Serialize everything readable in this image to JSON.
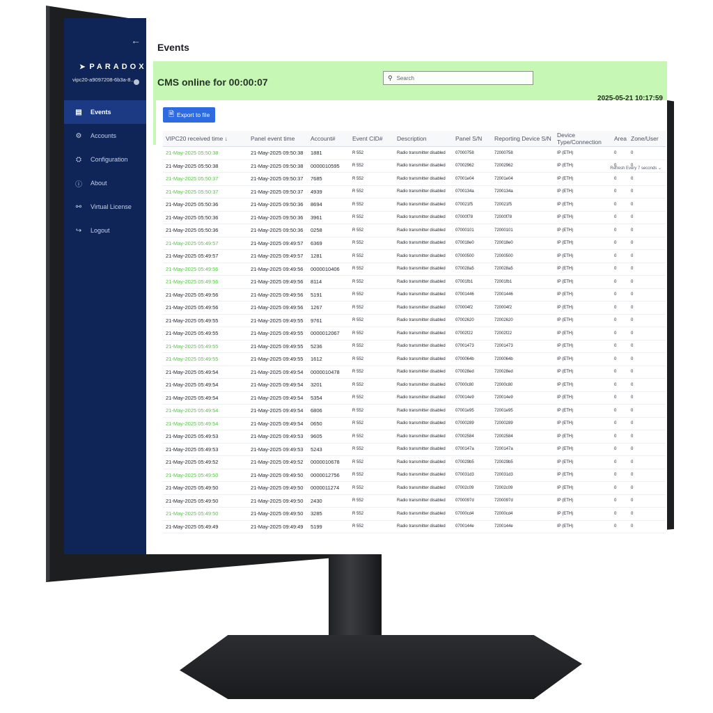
{
  "sidebar": {
    "brand": "PARADOX",
    "device_id": "vipc20-a9097208-6b3a-8...",
    "collapse_icon": "arrow-left-icon",
    "items": [
      {
        "label": "Events",
        "icon": "list-icon",
        "active": true
      },
      {
        "label": "Accounts",
        "icon": "accounts-icon"
      },
      {
        "label": "Configuration",
        "icon": "gear-icon"
      },
      {
        "label": "About",
        "icon": "info-icon"
      },
      {
        "label": "Virtual License",
        "icon": "key-icon"
      },
      {
        "label": "Logout",
        "icon": "logout-icon"
      }
    ]
  },
  "header": {
    "title": "Events",
    "cms_status": "CMS online for 00:00:07",
    "search_placeholder": "Search",
    "datetime": "2025-05-21 10:17:59"
  },
  "toolbar": {
    "export_label": "Export to file",
    "refresh_label": "Refresh Every  7 seconds"
  },
  "table": {
    "columns": [
      "VIPC20 received time ↓",
      "Panel event time",
      "Account#",
      "Event CID#",
      "Description",
      "Panel S/N",
      "Reporting Device S/N",
      "Device Type/Connection",
      "Area",
      "Zone/User"
    ],
    "rows": [
      {
        "received": "21-May-2025 05:50:38",
        "panel_time": "21-May-2025 09:50:38",
        "account": "1881",
        "cid": "R 552",
        "desc": "Radio transmitter disabled",
        "panel_sn": "07000758",
        "dev_sn": "72000758",
        "type": "IP (ETH)",
        "area": "0",
        "zone": "0",
        "green": true
      },
      {
        "received": "21-May-2025 05:50:38",
        "panel_time": "21-May-2025 09:50:38",
        "account": "0000010595",
        "cid": "R 552",
        "desc": "Radio transmitter disabled",
        "panel_sn": "07002962",
        "dev_sn": "72002962",
        "type": "IP (ETH)",
        "area": "0",
        "zone": "0",
        "green": false
      },
      {
        "received": "21-May-2025 05:50:37",
        "panel_time": "21-May-2025 09:50:37",
        "account": "7685",
        "cid": "R 552",
        "desc": "Radio transmitter disabled",
        "panel_sn": "07001e04",
        "dev_sn": "72001e04",
        "type": "IP (ETH)",
        "area": "0",
        "zone": "0",
        "green": true
      },
      {
        "received": "21-May-2025 05:50:37",
        "panel_time": "21-May-2025 09:50:37",
        "account": "4939",
        "cid": "R 552",
        "desc": "Radio transmitter disabled",
        "panel_sn": "0700134a",
        "dev_sn": "7200134a",
        "type": "IP (ETH)",
        "area": "0",
        "zone": "0",
        "green": true
      },
      {
        "received": "21-May-2025 05:50:36",
        "panel_time": "21-May-2025 09:50:36",
        "account": "8694",
        "cid": "R 552",
        "desc": "Radio transmitter disabled",
        "panel_sn": "070021f5",
        "dev_sn": "720021f5",
        "type": "IP (ETH)",
        "area": "0",
        "zone": "0",
        "green": false
      },
      {
        "received": "21-May-2025 05:50:36",
        "panel_time": "21-May-2025 09:50:36",
        "account": "3961",
        "cid": "R 552",
        "desc": "Radio transmitter disabled",
        "panel_sn": "07000f78",
        "dev_sn": "72000f78",
        "type": "IP (ETH)",
        "area": "0",
        "zone": "0",
        "green": false
      },
      {
        "received": "21-May-2025 05:50:36",
        "panel_time": "21-May-2025 09:50:36",
        "account": "0258",
        "cid": "R 552",
        "desc": "Radio transmitter disabled",
        "panel_sn": "07000101",
        "dev_sn": "72000101",
        "type": "IP (ETH)",
        "area": "0",
        "zone": "0",
        "green": false
      },
      {
        "received": "21-May-2025 05:49:57",
        "panel_time": "21-May-2025 09:49:57",
        "account": "6369",
        "cid": "R 552",
        "desc": "Radio transmitter disabled",
        "panel_sn": "070018e0",
        "dev_sn": "720018e0",
        "type": "IP (ETH)",
        "area": "0",
        "zone": "0",
        "green": true
      },
      {
        "received": "21-May-2025 05:49:57",
        "panel_time": "21-May-2025 09:49:57",
        "account": "1281",
        "cid": "R 552",
        "desc": "Radio transmitter disabled",
        "panel_sn": "07000500",
        "dev_sn": "72000500",
        "type": "IP (ETH)",
        "area": "0",
        "zone": "0",
        "green": false
      },
      {
        "received": "21-May-2025 05:49:56",
        "panel_time": "21-May-2025 09:49:56",
        "account": "0000010406",
        "cid": "R 552",
        "desc": "Radio transmitter disabled",
        "panel_sn": "070028a5",
        "dev_sn": "720028a5",
        "type": "IP (ETH)",
        "area": "0",
        "zone": "0",
        "green": true
      },
      {
        "received": "21-May-2025 05:49:56",
        "panel_time": "21-May-2025 09:49:56",
        "account": "8114",
        "cid": "R 552",
        "desc": "Radio transmitter disabled",
        "panel_sn": "07001fb1",
        "dev_sn": "72001fb1",
        "type": "IP (ETH)",
        "area": "0",
        "zone": "0",
        "green": true
      },
      {
        "received": "21-May-2025 05:49:56",
        "panel_time": "21-May-2025 09:49:56",
        "account": "5191",
        "cid": "R 552",
        "desc": "Radio transmitter disabled",
        "panel_sn": "07001446",
        "dev_sn": "72001446",
        "type": "IP (ETH)",
        "area": "0",
        "zone": "0",
        "green": false
      },
      {
        "received": "21-May-2025 05:49:56",
        "panel_time": "21-May-2025 09:49:56",
        "account": "1267",
        "cid": "R 552",
        "desc": "Radio transmitter disabled",
        "panel_sn": "070004f2",
        "dev_sn": "720004f2",
        "type": "IP (ETH)",
        "area": "0",
        "zone": "0",
        "green": false
      },
      {
        "received": "21-May-2025 05:49:55",
        "panel_time": "21-May-2025 09:49:55",
        "account": "9761",
        "cid": "R 552",
        "desc": "Radio transmitter disabled",
        "panel_sn": "07002620",
        "dev_sn": "72002620",
        "type": "IP (ETH)",
        "area": "0",
        "zone": "0",
        "green": false
      },
      {
        "received": "21-May-2025 05:49:55",
        "panel_time": "21-May-2025 09:49:55",
        "account": "0000012067",
        "cid": "R 552",
        "desc": "Radio transmitter disabled",
        "panel_sn": "07002f22",
        "dev_sn": "72002f22",
        "type": "IP (ETH)",
        "area": "0",
        "zone": "0",
        "green": false
      },
      {
        "received": "21-May-2025 05:49:55",
        "panel_time": "21-May-2025 09:49:55",
        "account": "5236",
        "cid": "R 552",
        "desc": "Radio transmitter disabled",
        "panel_sn": "07001473",
        "dev_sn": "72001473",
        "type": "IP (ETH)",
        "area": "0",
        "zone": "0",
        "green": true
      },
      {
        "received": "21-May-2025 05:49:55",
        "panel_time": "21-May-2025 09:49:55",
        "account": "1612",
        "cid": "R 552",
        "desc": "Radio transmitter disabled",
        "panel_sn": "0700064b",
        "dev_sn": "7200064b",
        "type": "IP (ETH)",
        "area": "0",
        "zone": "0",
        "green": true
      },
      {
        "received": "21-May-2025 05:49:54",
        "panel_time": "21-May-2025 09:49:54",
        "account": "0000010478",
        "cid": "R 552",
        "desc": "Radio transmitter disabled",
        "panel_sn": "070028ed",
        "dev_sn": "720028ed",
        "type": "IP (ETH)",
        "area": "0",
        "zone": "0",
        "green": false
      },
      {
        "received": "21-May-2025 05:49:54",
        "panel_time": "21-May-2025 09:49:54",
        "account": "3201",
        "cid": "R 552",
        "desc": "Radio transmitter disabled",
        "panel_sn": "07000c80",
        "dev_sn": "72000c80",
        "type": "IP (ETH)",
        "area": "0",
        "zone": "0",
        "green": false
      },
      {
        "received": "21-May-2025 05:49:54",
        "panel_time": "21-May-2025 09:49:54",
        "account": "5354",
        "cid": "R 552",
        "desc": "Radio transmitter disabled",
        "panel_sn": "070014e9",
        "dev_sn": "720014e9",
        "type": "IP (ETH)",
        "area": "0",
        "zone": "0",
        "green": false
      },
      {
        "received": "21-May-2025 05:49:54",
        "panel_time": "21-May-2025 09:49:54",
        "account": "6806",
        "cid": "R 552",
        "desc": "Radio transmitter disabled",
        "panel_sn": "07001e95",
        "dev_sn": "72001e95",
        "type": "IP (ETH)",
        "area": "0",
        "zone": "0",
        "green": true
      },
      {
        "received": "21-May-2025 05:49:54",
        "panel_time": "21-May-2025 09:49:54",
        "account": "0650",
        "cid": "R 552",
        "desc": "Radio transmitter disabled",
        "panel_sn": "07000289",
        "dev_sn": "72000289",
        "type": "IP (ETH)",
        "area": "0",
        "zone": "0",
        "green": true
      },
      {
        "received": "21-May-2025 05:49:53",
        "panel_time": "21-May-2025 09:49:53",
        "account": "9605",
        "cid": "R 552",
        "desc": "Radio transmitter disabled",
        "panel_sn": "07002584",
        "dev_sn": "72002584",
        "type": "IP (ETH)",
        "area": "0",
        "zone": "0",
        "green": false
      },
      {
        "received": "21-May-2025 05:49:53",
        "panel_time": "21-May-2025 09:49:53",
        "account": "5243",
        "cid": "R 552",
        "desc": "Radio transmitter disabled",
        "panel_sn": "0700147a",
        "dev_sn": "7200147a",
        "type": "IP (ETH)",
        "area": "0",
        "zone": "0",
        "green": false
      },
      {
        "received": "21-May-2025 05:49:52",
        "panel_time": "21-May-2025 09:49:52",
        "account": "0000010678",
        "cid": "R 552",
        "desc": "Radio transmitter disabled",
        "panel_sn": "070029b5",
        "dev_sn": "720029b5",
        "type": "IP (ETH)",
        "area": "0",
        "zone": "0",
        "green": false
      },
      {
        "received": "21-May-2025 05:49:50",
        "panel_time": "21-May-2025 09:49:50",
        "account": "0000012756",
        "cid": "R 552",
        "desc": "Radio transmitter disabled",
        "panel_sn": "070031d3",
        "dev_sn": "720031d3",
        "type": "IP (ETH)",
        "area": "0",
        "zone": "0",
        "green": true
      },
      {
        "received": "21-May-2025 05:49:50",
        "panel_time": "21-May-2025 09:49:50",
        "account": "0000011274",
        "cid": "R 552",
        "desc": "Radio transmitter disabled",
        "panel_sn": "07002c09",
        "dev_sn": "72002c09",
        "type": "IP (ETH)",
        "area": "0",
        "zone": "0",
        "green": false
      },
      {
        "received": "21-May-2025 05:49:50",
        "panel_time": "21-May-2025 09:49:50",
        "account": "2430",
        "cid": "R 552",
        "desc": "Radio transmitter disabled",
        "panel_sn": "0700097d",
        "dev_sn": "7200097d",
        "type": "IP (ETH)",
        "area": "0",
        "zone": "0",
        "green": false
      },
      {
        "received": "21-May-2025 05:49:50",
        "panel_time": "21-May-2025 09:49:50",
        "account": "3285",
        "cid": "R 552",
        "desc": "Radio transmitter disabled",
        "panel_sn": "07000cd4",
        "dev_sn": "72000cd4",
        "type": "IP (ETH)",
        "area": "0",
        "zone": "0",
        "green": true
      },
      {
        "received": "21-May-2025 05:49:49",
        "panel_time": "21-May-2025 09:49:49",
        "account": "5199",
        "cid": "R 552",
        "desc": "Radio transmitter disabled",
        "panel_sn": "0700144e",
        "dev_sn": "7200144e",
        "type": "IP (ETH)",
        "area": "0",
        "zone": "0",
        "green": false
      }
    ]
  },
  "colors": {
    "sidebar_bg": "#0f2557",
    "sidebar_active": "#1c3a84",
    "status_bg": "#c6f7b4",
    "accent": "#2f6be0",
    "green_text": "#59c24a"
  }
}
